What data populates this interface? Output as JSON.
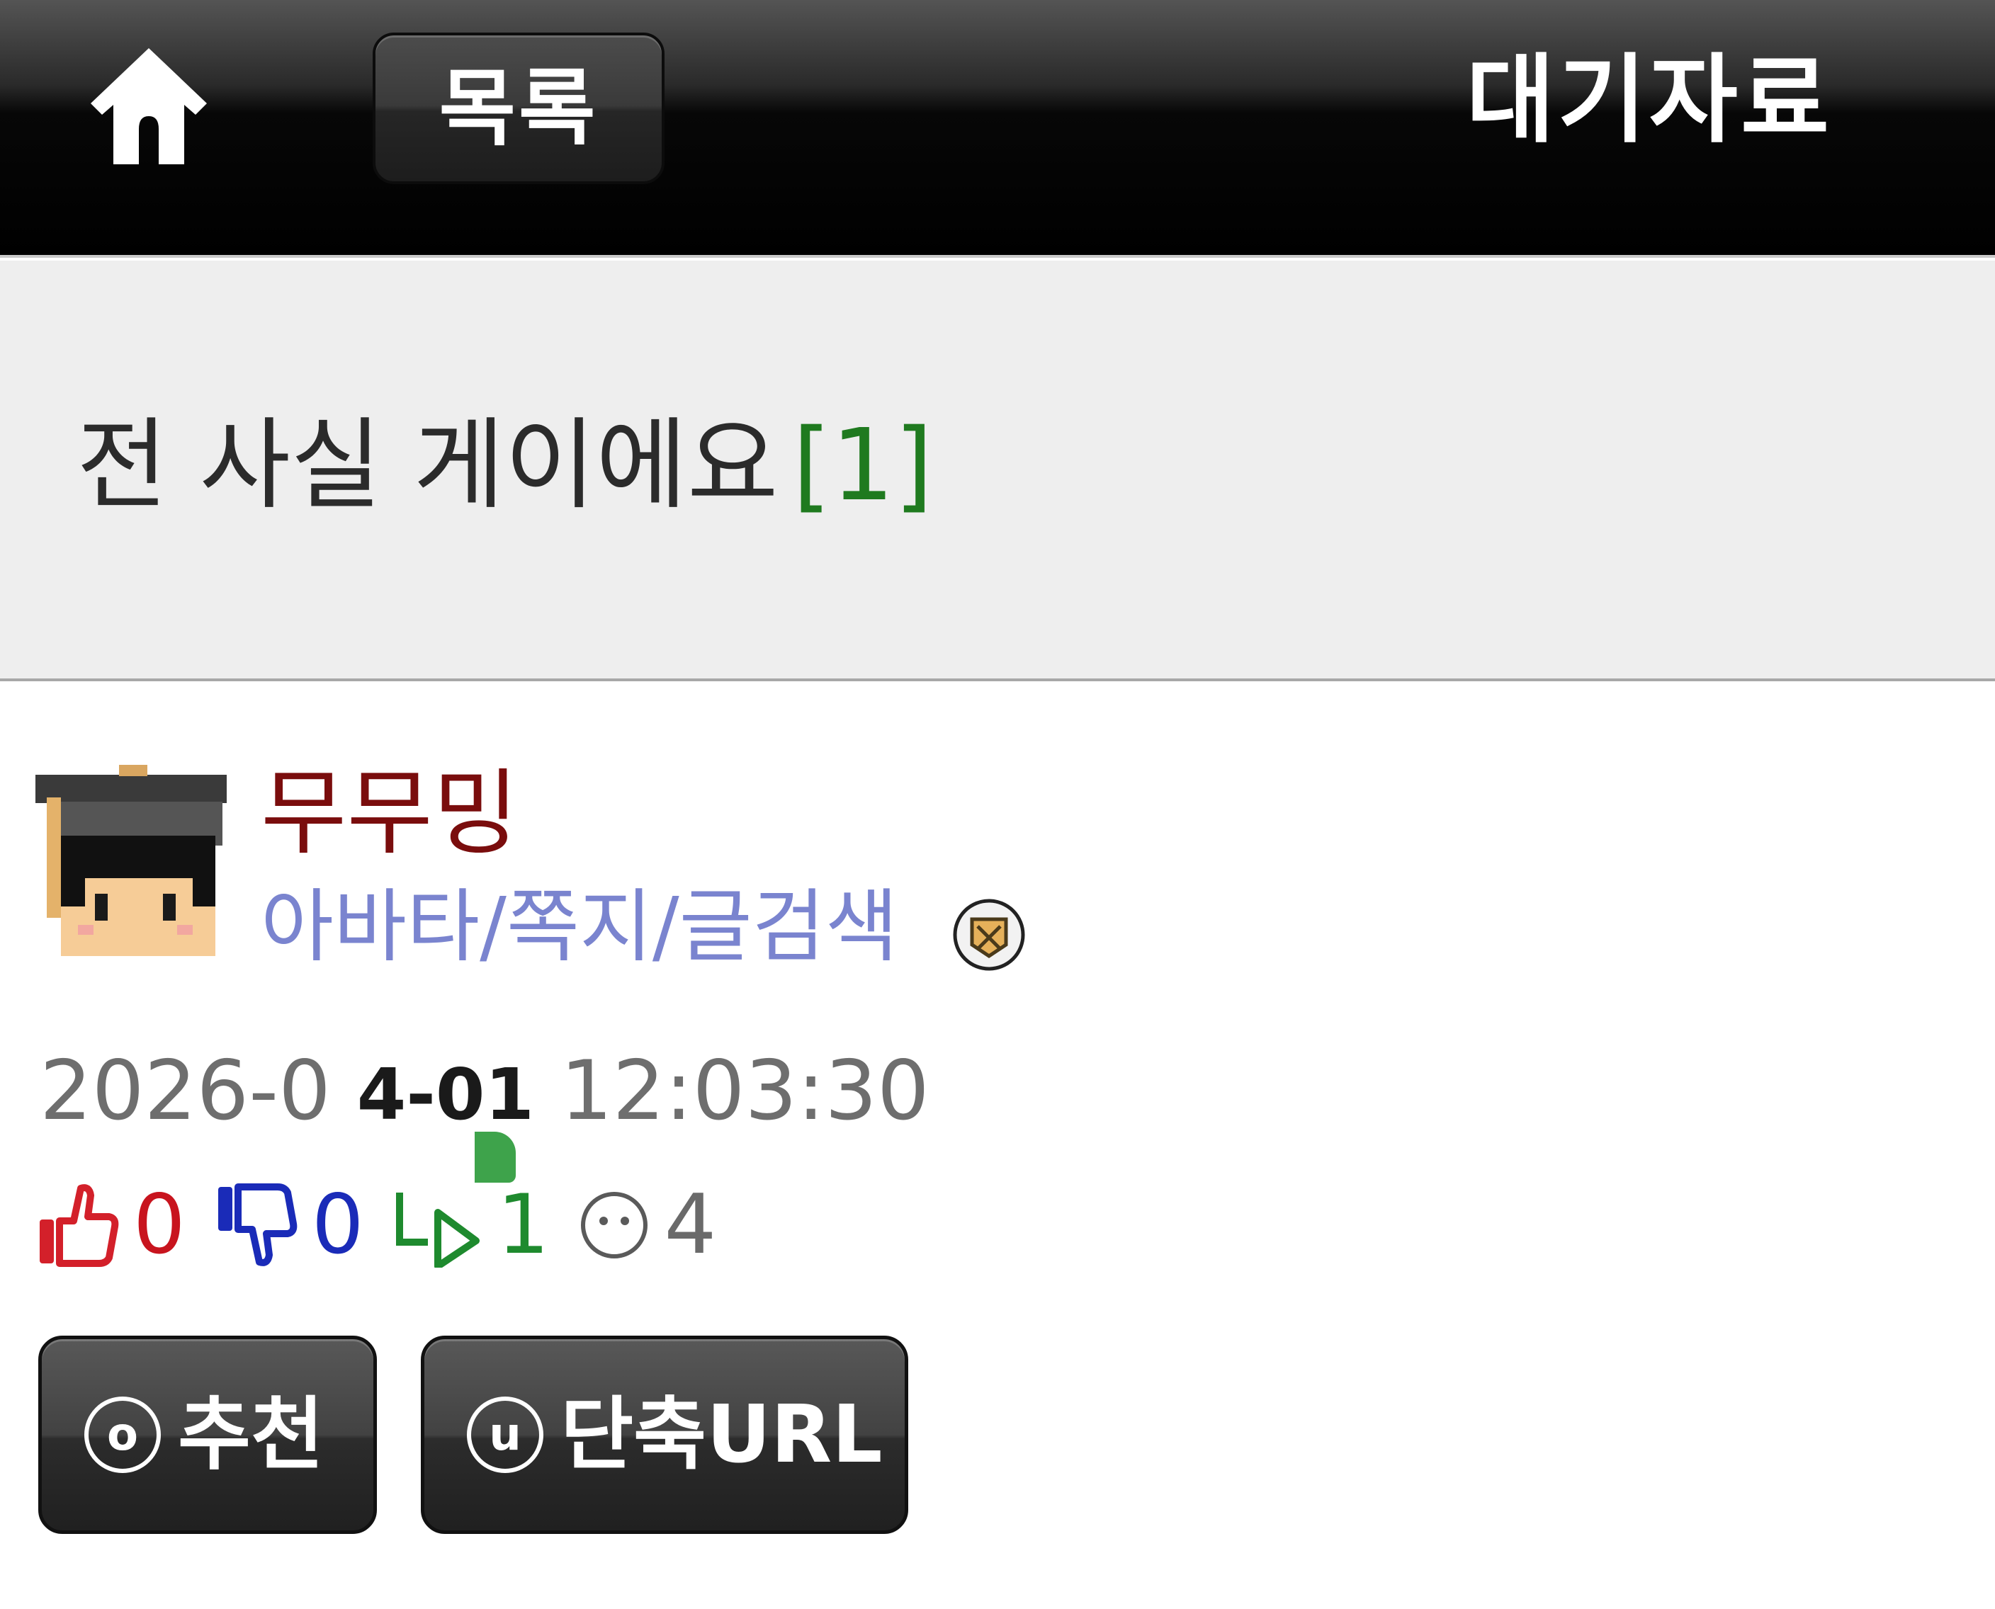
{
  "header": {
    "home_icon": "home-icon",
    "list_label": "목록",
    "board_title": "대기자료"
  },
  "post": {
    "title": "전 사실 게이에요",
    "comment_count": "[1]"
  },
  "author": {
    "name": "무무밍",
    "links": "아바타/쪽지/글검색",
    "avatar_icon": "avatar-graduate-icon",
    "badge_icon": "level-badge-icon"
  },
  "date": {
    "prefix": "2026-0",
    "bold": "4-01",
    "time": "12:03:30"
  },
  "stats": {
    "upvotes": "0",
    "downvotes": "0",
    "replies": "1",
    "views": "4"
  },
  "actions": {
    "recommend_key": "o",
    "recommend_label": "추천",
    "shorturl_key": "u",
    "shorturl_label": "단축URL"
  },
  "colors": {
    "author_name": "#7a0d0d",
    "author_links": "#7a84cf",
    "comment_count": "#1f7a1f",
    "upvote": "#c8141e",
    "downvote": "#1a2bb8",
    "reply": "#1e8a2e",
    "views": "#6a6a6a"
  }
}
